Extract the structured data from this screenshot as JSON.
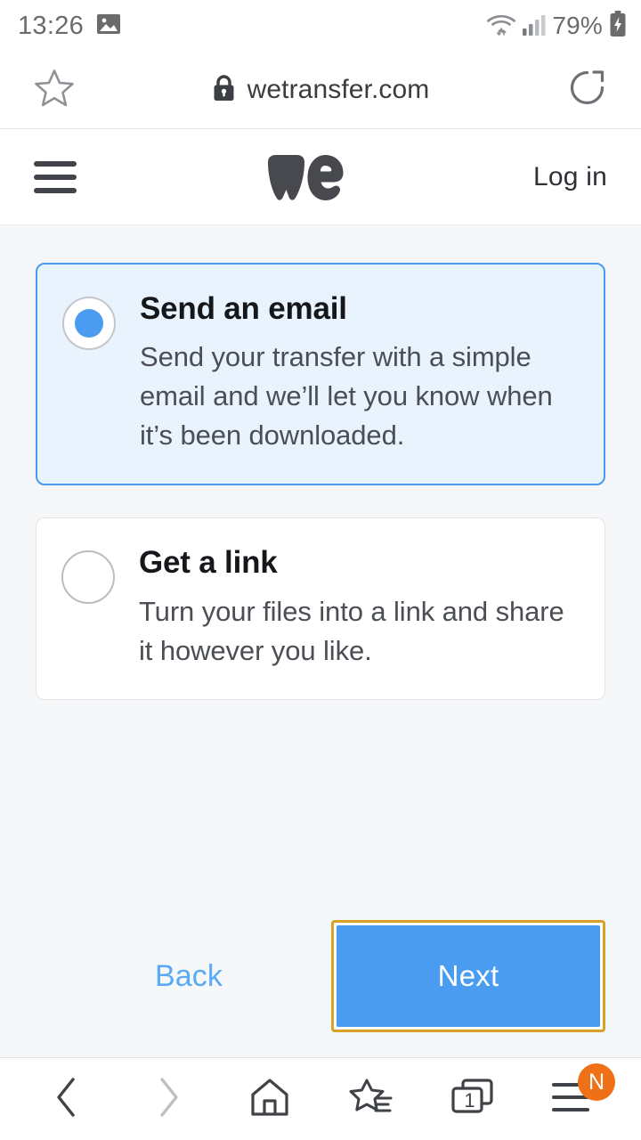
{
  "statusbar": {
    "time": "13:26",
    "notification_icon": "image-icon",
    "wifi_icon": "wifi-icon",
    "signal_icon": "cellular-signal-icon",
    "battery_percent": "79%",
    "battery_icon": "battery-charging-icon"
  },
  "browser": {
    "bookmark_icon": "star-outline-icon",
    "lock_icon": "lock-icon",
    "url": "wetransfer.com",
    "reload_icon": "reload-icon"
  },
  "site_header": {
    "menu_icon": "hamburger-menu-icon",
    "logo": "wetransfer-we-logo",
    "login_label": "Log in"
  },
  "main": {
    "options": [
      {
        "title": "Send an email",
        "description": "Send your transfer with a simple email and we’ll let you know when it’s been downloaded.",
        "selected": true
      },
      {
        "title": "Get a link",
        "description": "Turn your files into a link and share it however you like.",
        "selected": false
      }
    ],
    "back_label": "Back",
    "next_label": "Next"
  },
  "bottomnav": {
    "items": [
      {
        "icon": "back-chevron-icon",
        "label": "Back"
      },
      {
        "icon": "forward-chevron-icon",
        "label": "Forward"
      },
      {
        "icon": "home-icon",
        "label": "Home"
      },
      {
        "icon": "bookmarks-star-icon",
        "label": "Bookmarks"
      },
      {
        "icon": "tabs-icon",
        "label": "Tabs"
      },
      {
        "icon": "menu-icon",
        "label": "Menu"
      }
    ],
    "tab_count": "1",
    "menu_badge": "N"
  },
  "colors": {
    "accent_blue": "#4a9cf0",
    "selected_card_bg": "#e9f3fd",
    "page_bg": "#f6f7f9",
    "focus_outline": "#d9a227",
    "badge_orange": "#ef7016"
  }
}
